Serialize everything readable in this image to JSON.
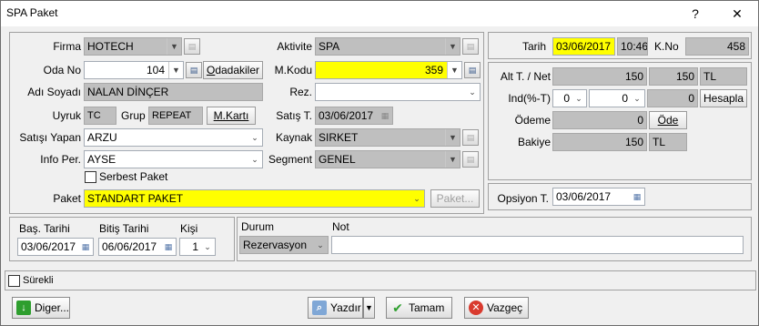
{
  "window": {
    "title": "SPA Paket",
    "help": "?",
    "close": "✕"
  },
  "left": {
    "firma": {
      "label": "Firma",
      "value": "HOTECH"
    },
    "aktivite": {
      "label": "Aktivite",
      "value": "SPA"
    },
    "oda_no": {
      "label": "Oda No",
      "value": "104"
    },
    "odadakiler_button": "Odadakiler",
    "odadakiler_accel": "O",
    "m_kodu": {
      "label": "M.Kodu",
      "value": "359"
    },
    "adi_soyadi": {
      "label": "Adı Soyadı",
      "value": "NALAN DİNÇER"
    },
    "rez": {
      "label": "Rez.",
      "value": ""
    },
    "uyruk": {
      "label": "Uyruk",
      "value": "TC"
    },
    "grup": {
      "label": "Grup",
      "value": "REPEAT"
    },
    "m_karti_button": "M.Kartı",
    "satis_t": {
      "label": "Satış T.",
      "value": "03/06/2017"
    },
    "satisi_yapan": {
      "label": "Satışı Yapan",
      "value": "ARZU"
    },
    "kaynak": {
      "label": "Kaynak",
      "value": "SIRKET"
    },
    "info_per": {
      "label": "Info Per.",
      "value": "AYSE"
    },
    "segment": {
      "label": "Segment",
      "value": "GENEL"
    },
    "serbest_paket": {
      "label": "Serbest Paket",
      "checked": false
    },
    "paket": {
      "label": "Paket",
      "value": "STANDART PAKET"
    },
    "paket_button": "Paket..."
  },
  "right": {
    "tarih": {
      "label": "Tarih",
      "date": "03/06/2017",
      "time": "10:46"
    },
    "k_no": {
      "label": "K.No",
      "value": "458"
    },
    "alt_net": {
      "label": "Alt T. / Net",
      "value1": "150",
      "value2": "150",
      "currency": "TL"
    },
    "ind": {
      "label": "Ind(%-T)",
      "pct": "0",
      "amt": "0",
      "value": "0"
    },
    "hesapla_button": "Hesapla",
    "odeme": {
      "label": "Ödeme",
      "value": "0"
    },
    "ode_button": "Öde",
    "bakiye": {
      "label": "Bakiye",
      "value": "150",
      "currency": "TL"
    },
    "opsiyon": {
      "label": "Opsiyon T.",
      "value": "03/06/2017"
    }
  },
  "dates": {
    "bas_tarihi": {
      "label": "Baş. Tarihi",
      "value": "03/06/2017"
    },
    "bitis_tarihi": {
      "label": "Bitiş Tarihi",
      "value": "06/06/2017"
    },
    "kisi": {
      "label": "Kişi",
      "value": "1"
    }
  },
  "status": {
    "durum": {
      "label": "Durum",
      "value": "Rezervasyon"
    },
    "not": {
      "label": "Not",
      "value": ""
    }
  },
  "surekli": {
    "label": "Sürekli",
    "checked": false
  },
  "footer": {
    "diger": "Diger...",
    "yazdir": "Yazdır",
    "tamam": "Tamam",
    "vazgec": "Vazgeç"
  },
  "colors": {
    "highlight": "#ffff00",
    "readonly": "#bfbfbf",
    "background": "#f0f0f0"
  }
}
